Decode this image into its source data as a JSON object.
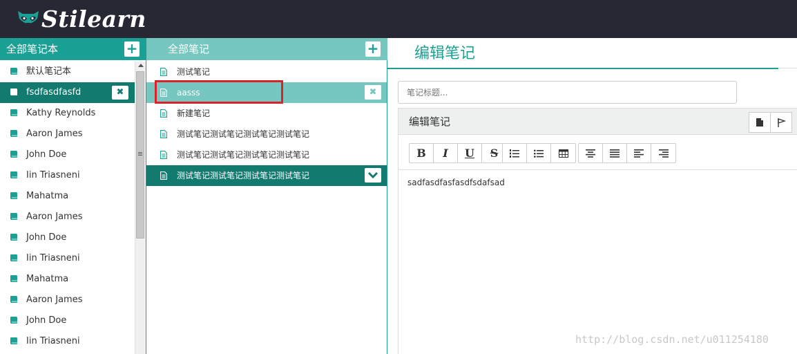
{
  "app": {
    "name": "Stilearn"
  },
  "notebooks": {
    "header": "全部笔记本",
    "add_symbol": "+",
    "delete_symbol": "✖",
    "items": [
      {
        "label": "默认笔记本"
      },
      {
        "label": "fsdfasdfasfd",
        "active": true
      },
      {
        "label": "Kathy Reynolds"
      },
      {
        "label": "Aaron James"
      },
      {
        "label": "John Doe"
      },
      {
        "label": "Iin Triasneni"
      },
      {
        "label": "Mahatma"
      },
      {
        "label": "Aaron James"
      },
      {
        "label": "John Doe"
      },
      {
        "label": "Iin Triasneni"
      },
      {
        "label": "Mahatma"
      },
      {
        "label": "Aaron James"
      },
      {
        "label": "John Doe"
      },
      {
        "label": "Iin Triasneni"
      }
    ]
  },
  "notes": {
    "header": "全部笔记",
    "add_symbol": "+",
    "delete_symbol": "✖",
    "items": [
      {
        "label": "测试笔记"
      },
      {
        "label": "aasss",
        "highlighted": true
      },
      {
        "label": "新建笔记"
      },
      {
        "label": "测试笔记测试笔记测试笔记测试笔记"
      },
      {
        "label": "测试笔记测试笔记测试笔记测试笔记"
      },
      {
        "label": "测试笔记测试笔记测试笔记测试笔记",
        "active": true
      }
    ]
  },
  "editor": {
    "title": "编辑笔记",
    "title_placeholder": "笔记标题...",
    "panel_title": "编辑笔记",
    "toolbar": {
      "bold": "B",
      "italic": "I",
      "underline": "U",
      "strike": "S"
    },
    "content": "sadfasdfasfasdfsdafsad"
  },
  "watermark": "http://blog.csdn.net/u011254180",
  "colors": {
    "accent": "#1aa094",
    "accent_dark": "#127a6f",
    "accent_light": "#76c7c0",
    "topbar": "#272833",
    "highlight_box": "#d9222a"
  }
}
